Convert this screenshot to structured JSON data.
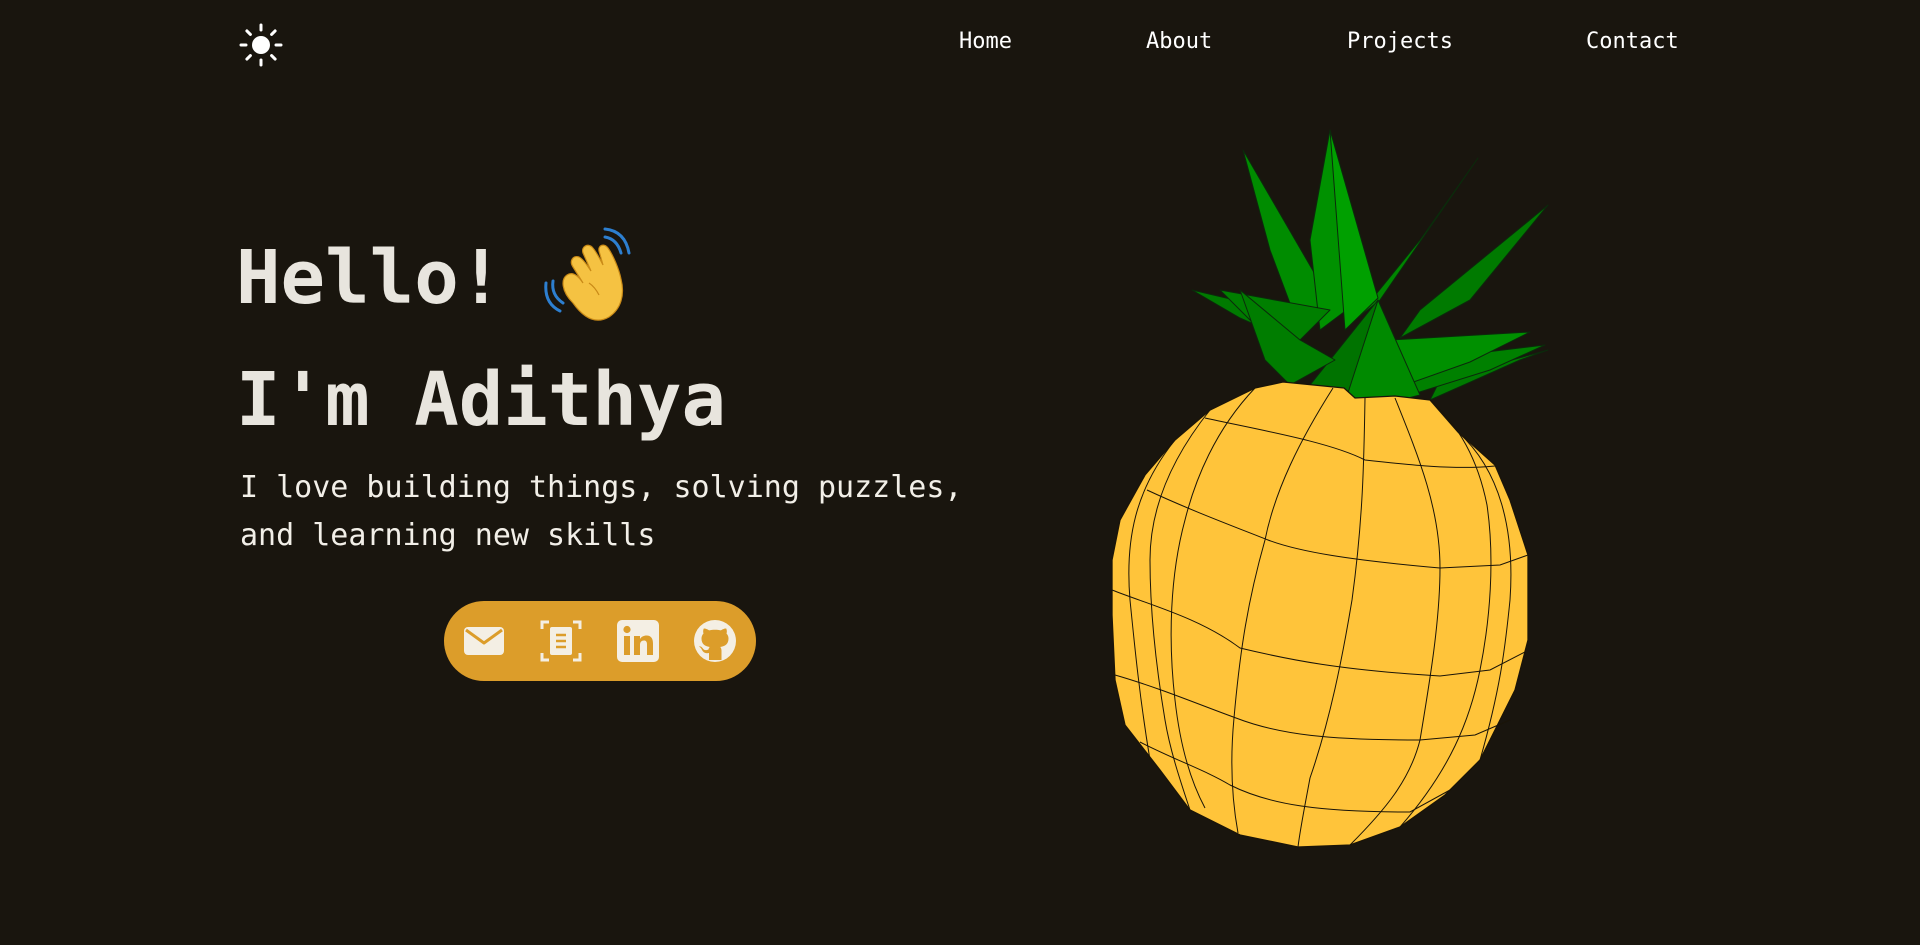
{
  "nav": {
    "theme_toggle_icon": "sun-icon",
    "items": [
      {
        "label": "Home"
      },
      {
        "label": "About"
      },
      {
        "label": "Projects"
      },
      {
        "label": "Contact"
      }
    ]
  },
  "hero": {
    "greeting": "Hello!",
    "greeting_emoji_icon": "waving-hand-icon",
    "name_line": "I'm Adithya",
    "tagline_line1": "I love building things, solving puzzles,",
    "tagline_line2": "and learning new skills"
  },
  "social": {
    "background_color": "#dc9d2a",
    "icons": [
      "mail-icon",
      "resume-icon",
      "linkedin-icon",
      "github-icon"
    ]
  },
  "illustration": {
    "name": "pineapple-3d-model",
    "body_color": "#ffc43a",
    "leaf_color": "#008000"
  },
  "colors": {
    "background": "#19150e",
    "text": "#ece9e2"
  }
}
